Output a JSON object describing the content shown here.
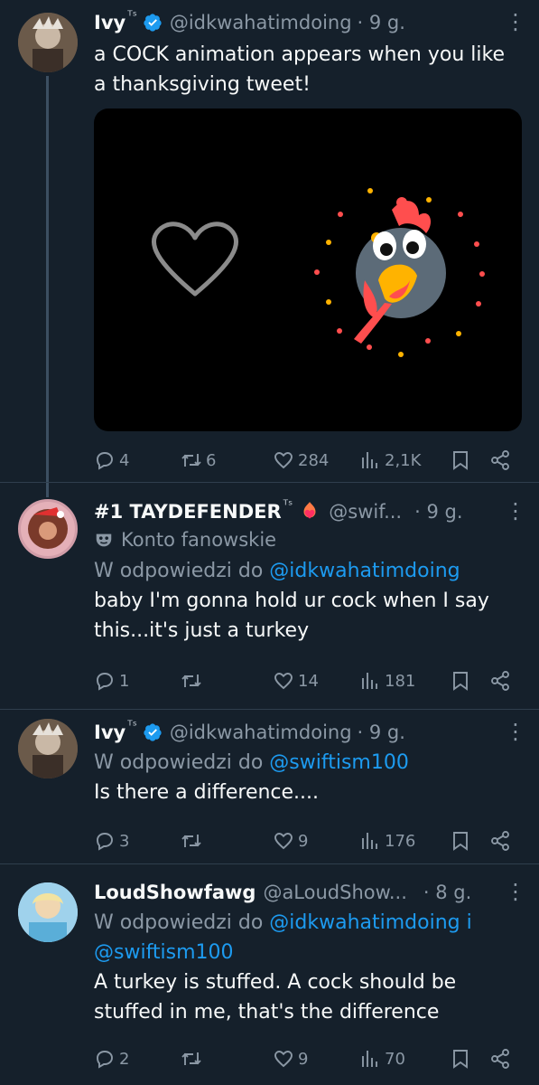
{
  "tweets": [
    {
      "name": "Ivy",
      "badge": "ᵀˢ",
      "handle": "@idkwahatimdoing",
      "time": "· 9 g.",
      "text": "a COCK animation appears when you like a thanksgiving tweet!",
      "actions": {
        "replies": "4",
        "retweets": "6",
        "likes": "284",
        "views": "2,1K"
      }
    },
    {
      "name": "#1 TAYDEFENDER",
      "badge": "ᵀˢ",
      "handle": "@swif...",
      "time": "· 9 g.",
      "fan_label": "Konto fanowskie",
      "reply_prefix": "W odpowiedzi do ",
      "reply_to": "@idkwahatimdoing",
      "text": "baby I'm gonna hold ur cock when I say this...it's just a turkey",
      "actions": {
        "replies": "1",
        "retweets": "",
        "likes": "14",
        "views": "181"
      }
    },
    {
      "name": "Ivy",
      "badge": "ᵀˢ",
      "handle": "@idkwahatimdoing",
      "time": "· 9 g.",
      "reply_prefix": "W odpowiedzi do ",
      "reply_to": "@swiftism100",
      "text": "Is there a difference....",
      "actions": {
        "replies": "3",
        "retweets": "",
        "likes": "9",
        "views": "176"
      }
    },
    {
      "name": "LoudShowfawg",
      "handle": "@aLoudShow...",
      "time": "· 8 g.",
      "reply_prefix": "W odpowiedzi do ",
      "reply_to": "@idkwahatimdoing i",
      "reply_to_2": "@swiftism100",
      "text": "A turkey is stuffed. A cock should be stuffed in me, that's the difference",
      "actions": {
        "replies": "2",
        "retweets": "",
        "likes": "9",
        "views": "70"
      }
    }
  ],
  "icons": {
    "more": "more-dots-icon",
    "reply": "reply-bubble-icon",
    "retweet": "retweet-icon",
    "like": "heart-icon",
    "views": "views-bar-icon",
    "bookmark": "bookmark-icon",
    "share": "share-icon"
  },
  "colors": {
    "background": "#15202b",
    "accent": "#1d9bf0",
    "muted": "#8b98a5"
  }
}
